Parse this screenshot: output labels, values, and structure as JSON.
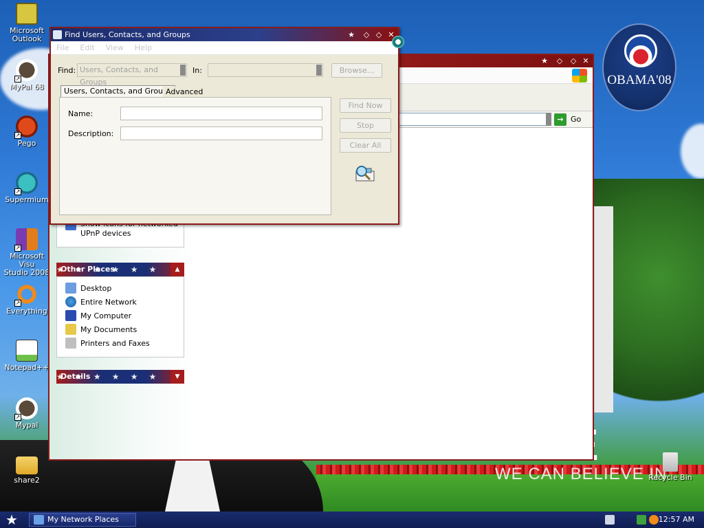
{
  "desktop": {
    "icons": [
      {
        "label": "Microsoft\nOutlook",
        "icon": "outlook-icon"
      },
      {
        "label": "MyPal 68",
        "icon": "mypal-icon"
      },
      {
        "label": "Pego",
        "icon": "pego-icon"
      },
      {
        "label": "Supermium",
        "icon": "supermium-icon"
      },
      {
        "label": "Microsoft Visu\nStudio 2008",
        "icon": "visual-studio-icon"
      },
      {
        "label": "Everything",
        "icon": "everything-icon"
      },
      {
        "label": "Notepad++",
        "icon": "notepadpp-icon"
      },
      {
        "label": "Mypal",
        "icon": "mypal-icon"
      },
      {
        "label": "share2",
        "icon": "folder-icon"
      }
    ],
    "recycle_bin": "Recycle Bin",
    "wallpaper": {
      "logo_text": "OBAMA'08",
      "slogan_big": "NGE",
      "slogan_small": "WE CAN BELIEVE IN"
    }
  },
  "explorer": {
    "address_go": "Go",
    "partial_task_text": "Show icons for networked\nUPnP devices",
    "other_places": {
      "header": "Other Places",
      "items": [
        "Desktop",
        "Entire Network",
        "My Computer",
        "My Documents",
        "Printers and Faxes"
      ]
    },
    "details_header": "Details"
  },
  "find_dialog": {
    "title": "Find Users, Contacts, and Groups",
    "menu": [
      "File",
      "Edit",
      "View",
      "Help"
    ],
    "find_label": "Find:",
    "find_value": "Users, Contacts, and Groups",
    "in_label": "In:",
    "browse_label": "Browse...",
    "tabs": [
      "Users, Contacts, and Groups",
      "Advanced"
    ],
    "name_label": "Name:",
    "description_label": "Description:",
    "find_now_label": "Find Now",
    "stop_label": "Stop",
    "clear_all_label": "Clear All"
  },
  "taskbar": {
    "task_button": "My Network Places",
    "clock": "12:57 AM"
  },
  "colors": {
    "titlebar_red": "#8a1a1a",
    "titlebar_blue": "#1b2c6b",
    "taskbar": "#1a2c6e"
  }
}
